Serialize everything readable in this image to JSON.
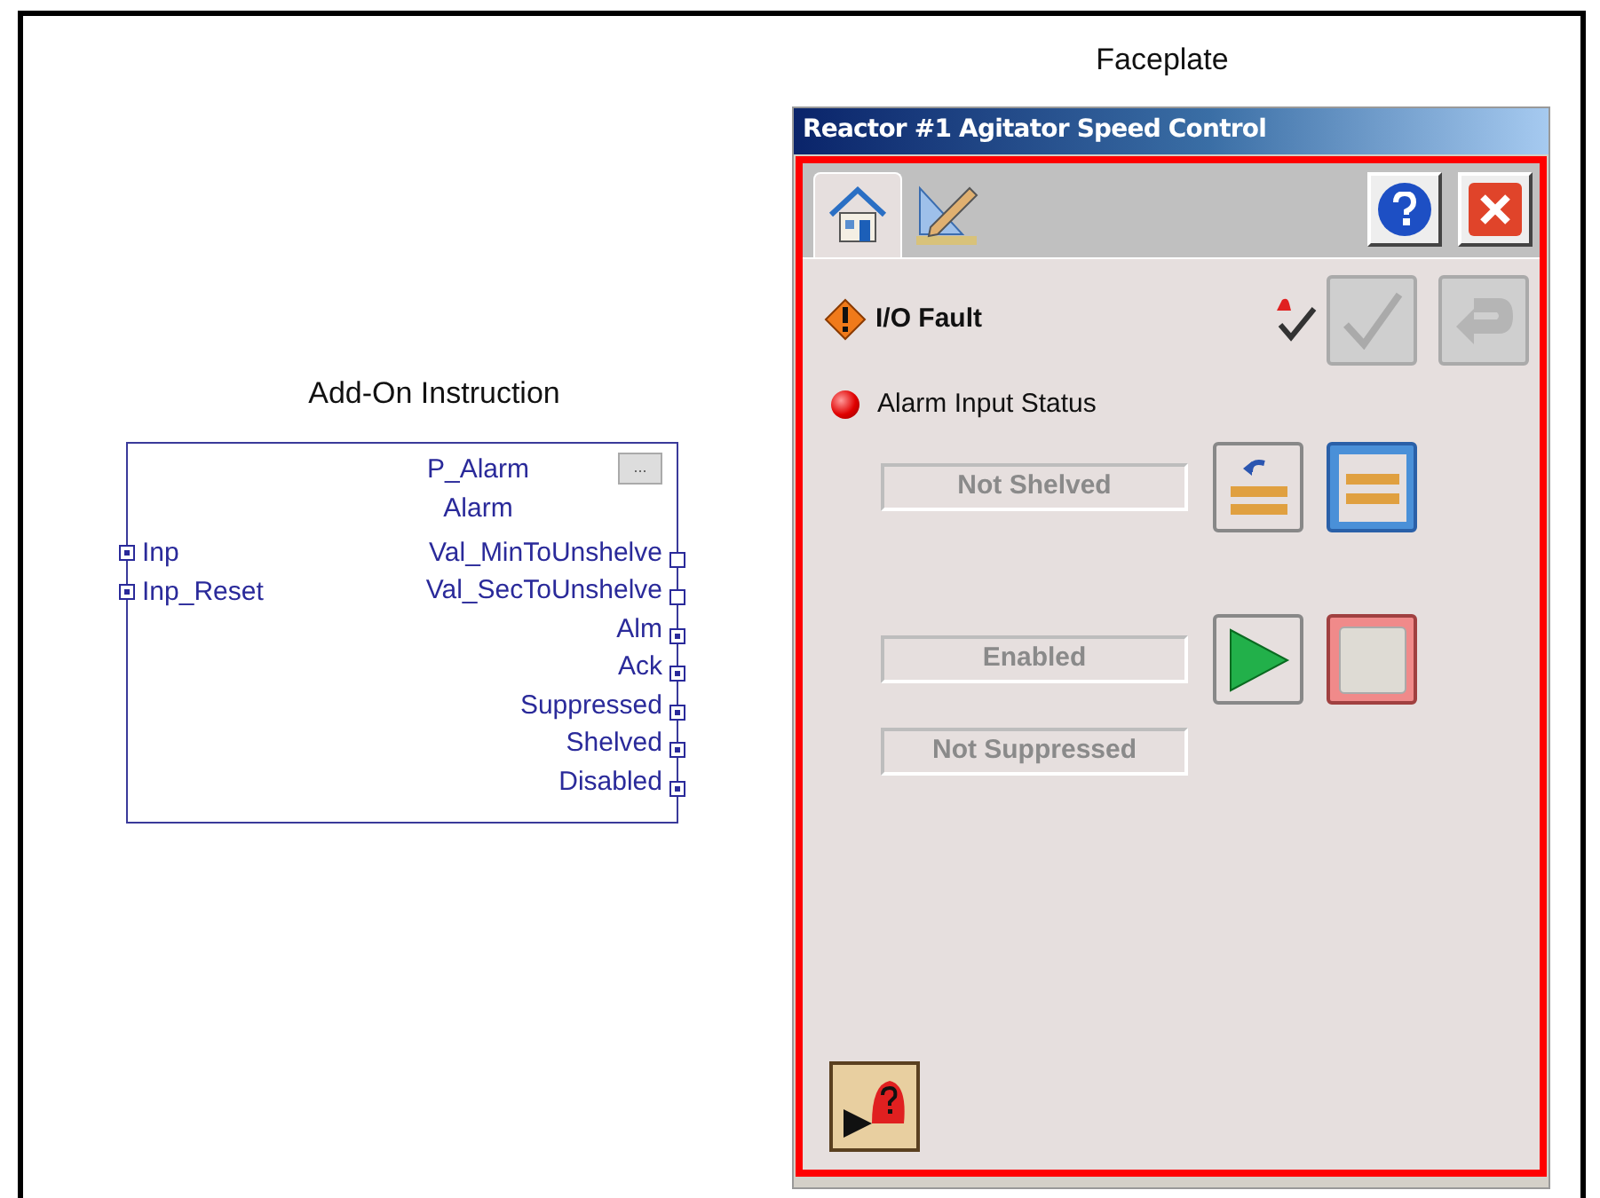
{
  "aoi": {
    "heading": "Add-On Instruction",
    "name": "P_Alarm",
    "type": "Alarm",
    "menu_button": "...",
    "inputs": [
      {
        "label": "Inp",
        "connected": true
      },
      {
        "label": "Inp_Reset",
        "connected": true
      }
    ],
    "outputs": [
      {
        "label": "Val_MinToUnshelve",
        "connected": false
      },
      {
        "label": "Val_SecToUnshelve",
        "connected": false
      },
      {
        "label": "Alm",
        "connected": true
      },
      {
        "label": "Ack",
        "connected": true
      },
      {
        "label": "Suppressed",
        "connected": true
      },
      {
        "label": "Shelved",
        "connected": true
      },
      {
        "label": "Disabled",
        "connected": true
      }
    ]
  },
  "faceplate": {
    "heading": "Faceplate",
    "title": "Reactor #1 Agitator Speed Control",
    "tabs": [
      {
        "kind": "home",
        "selected": true
      },
      {
        "kind": "engineering",
        "selected": false
      }
    ],
    "fault": {
      "label": "I/O Fault"
    },
    "ack_button": {
      "disabled": true
    },
    "reset_button": {
      "disabled": true
    },
    "alarm_status": {
      "label": "Alarm Input Status"
    },
    "shelve": {
      "status": "Not Shelved"
    },
    "enable": {
      "status": "Enabled"
    },
    "suppress": {
      "status": "Not Suppressed"
    }
  }
}
